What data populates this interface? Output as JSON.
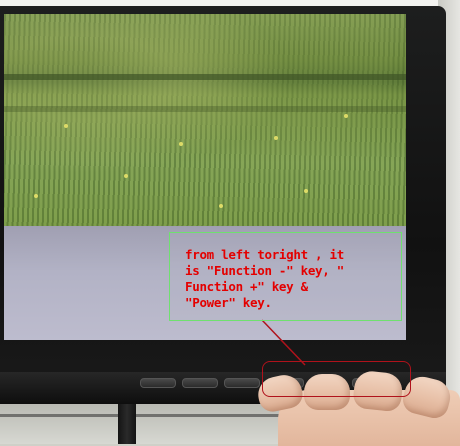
{
  "annotation": {
    "text": "from left toright , it\nis \"Function -\" key, \"\nFunction +\" key &\n\"Power\" key."
  },
  "colors": {
    "annotation_text": "#e40000",
    "annotation_border": "#6fe06f",
    "highlight_border": "#b0121b",
    "bezel": "#151515",
    "screen_lower": "#b2b2c5"
  },
  "icons": [
    "callout-arrow"
  ]
}
